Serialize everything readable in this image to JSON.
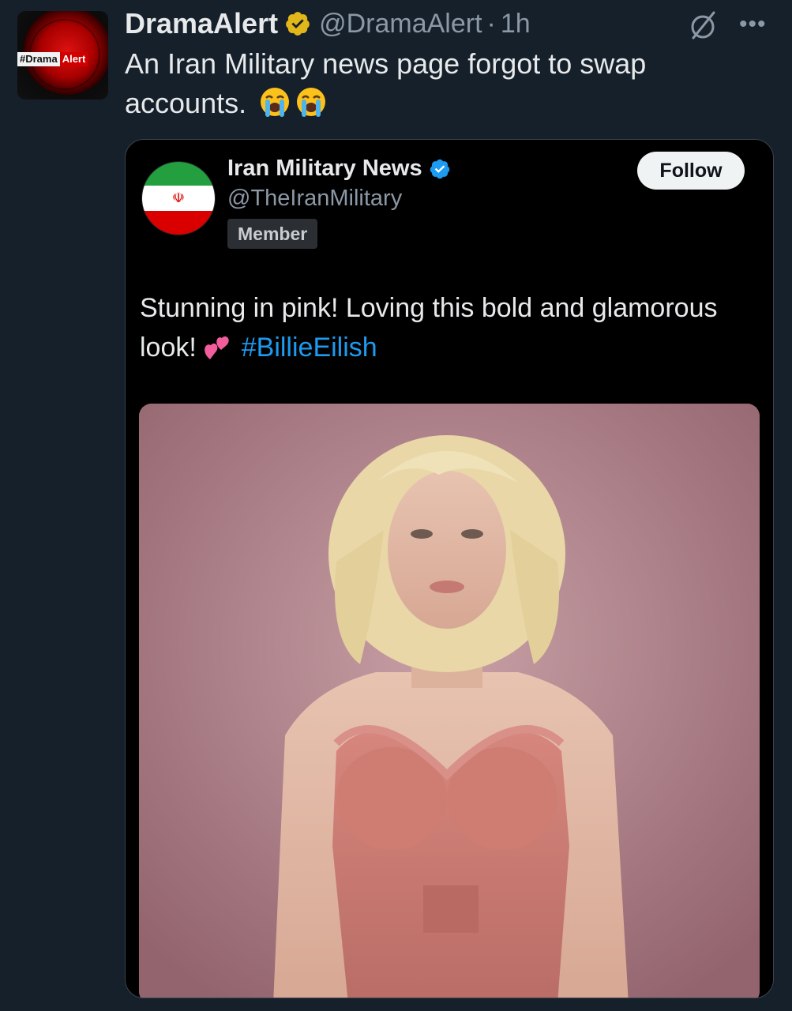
{
  "tweet": {
    "display_name": "DramaAlert",
    "handle": "@DramaAlert",
    "separator": "·",
    "time": "1h",
    "text": "An Iran Military news page forgot to swap accounts.",
    "avatar_logo": [
      "#Drama",
      "Alert"
    ],
    "icons": {
      "verified": "gold-verified-badge-icon",
      "grok": "grok-icon",
      "more": "more-options-icon",
      "emoji": "loudly-crying-face-icon"
    }
  },
  "quote": {
    "display_name": "Iran Military News",
    "handle": "@TheIranMilitary",
    "member_label": "Member",
    "follow_label": "Follow",
    "text": "Stunning in pink! Loving this bold and glamorous look!",
    "hashtag": "#BillieEilish",
    "icons": {
      "verified": "blue-verified-badge-icon",
      "emoji": "two-hearts-icon"
    },
    "photo": "photo-woman-in-pink-corset"
  },
  "colors": {
    "background": "#15202b",
    "card": "#000000",
    "link": "#1d9bf0",
    "muted": "#8b98a5",
    "gold_badge": "#e2b719",
    "blue_badge": "#1d9bf0"
  }
}
